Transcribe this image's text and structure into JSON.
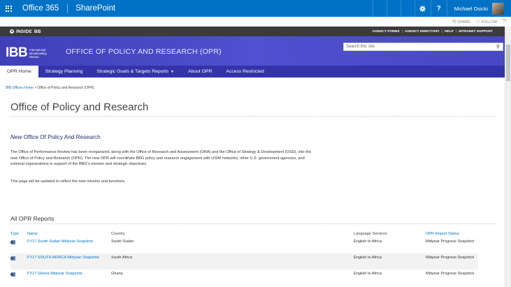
{
  "suite_bar": {
    "app_launcher": "waffle-icon",
    "product": "Office 365",
    "app": "SharePoint",
    "user_name": "Michael Osicki",
    "icons": [
      "gear-icon",
      "help-icon"
    ]
  },
  "actions": {
    "share": "SHARE",
    "follow": "FOLLOW"
  },
  "inside_bar": {
    "label": "INSIDE",
    "brand": "BB",
    "links": [
      "AGENCY FORMS",
      "AGENCY DIRECTORY",
      "HELP",
      "INTRANET SUPPORT"
    ]
  },
  "header": {
    "logo_text": "IBB",
    "logo_sub": [
      "International",
      "Broadcasting",
      "Bureau"
    ],
    "site_name": "OFFICE OF POLICY AND RESEARCH (OPR)",
    "search_placeholder": "Search this site"
  },
  "nav": {
    "items": [
      {
        "label": "OPR Home",
        "active": true
      },
      {
        "label": "Strategy Planning"
      },
      {
        "label": "Strategic Goals & Targets Reports",
        "dropdown": true
      },
      {
        "label": "About OPR"
      },
      {
        "label": "Access Restricted"
      }
    ]
  },
  "breadcrumb": {
    "root": "IBB Offices Home",
    "separator": ">",
    "current": "Office of Policy and Research (OPR)"
  },
  "page": {
    "title": "Office of Policy and Research",
    "subhead_em": "New",
    "subhead_rest": "Office Of Policy And Research",
    "paragraph1": "The Office of Performance Review has been reorganized, along with the Office of Research and Assessment (ORA) and the Office of Strategy & Development (OSD), into the new Office of Policy and Research (OPR).  The new OPR will coordinate BBG policy and research engagement with USIM networks, other U.S. government agencies, and external organizations in support of the BBG's mission and strategic objectives.",
    "paragraph2": "This page will be updated to reflect the new mission and functions."
  },
  "reports": {
    "section_title": "All OPR Reports",
    "columns": [
      "Type",
      "Name",
      "Country",
      "Language Services",
      "OPR Report Status"
    ],
    "rows": [
      {
        "name": "FY17 South Sudan Midyear Snapshot",
        "country": "South Sudan",
        "language": "English to Africa",
        "status": "Midyear Progress Snapshot"
      },
      {
        "name": "FY17 SOUTH AFRICA Midyear Snapshot",
        "country": "South Africa",
        "language": "English to Africa",
        "status": "Midyear Progress Snapshot"
      },
      {
        "name": "FY17 Ghana Midyear Snapshot",
        "country": "Ghana",
        "language": "English to Africa",
        "status": "Midyear Progress Snapshot"
      }
    ]
  },
  "colors": {
    "suite_blue": "#0072c6",
    "banner": "#4a4ac8",
    "nav": "#3333aa",
    "link": "#0072c6"
  }
}
